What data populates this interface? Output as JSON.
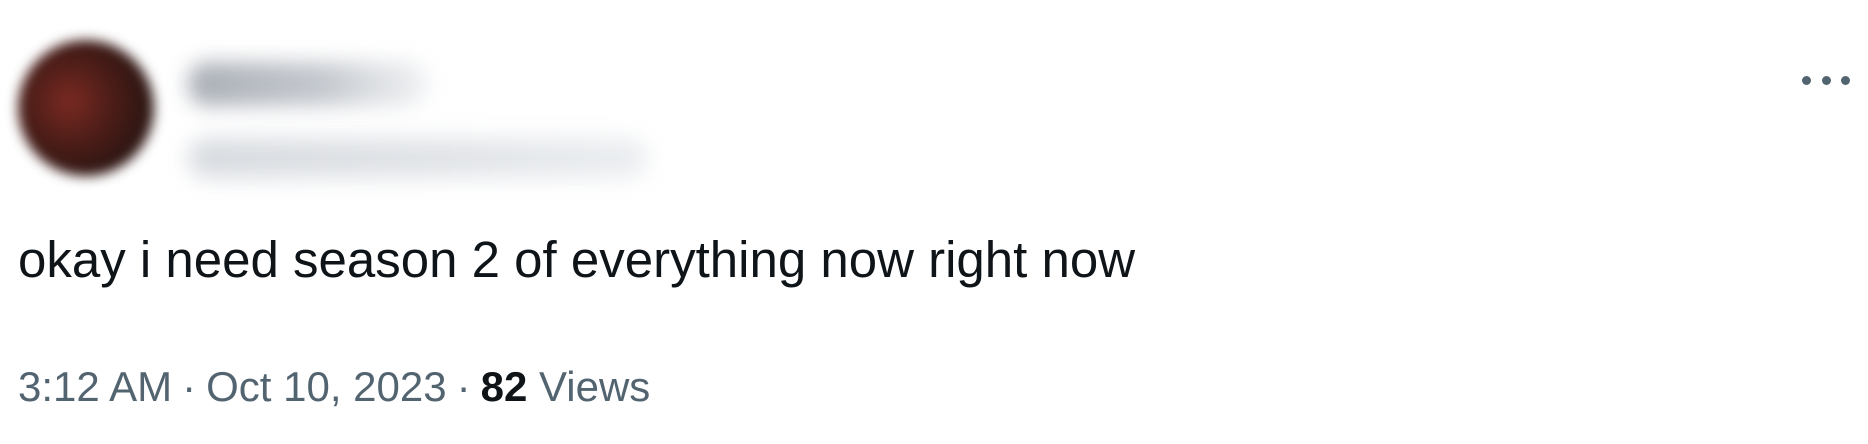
{
  "author": {
    "display_name": "",
    "handle": ""
  },
  "tweet": {
    "text": "okay i need season 2 of everything now right now",
    "time": "3:12 AM",
    "date": "Oct 10, 2023",
    "separator": "·",
    "views_count": "82",
    "views_label": "Views"
  },
  "icons": {
    "avatar": "avatar-image",
    "more": "more-options-icon"
  },
  "colors": {
    "text_primary": "#0f1419",
    "text_secondary": "#536471",
    "background": "#ffffff"
  }
}
